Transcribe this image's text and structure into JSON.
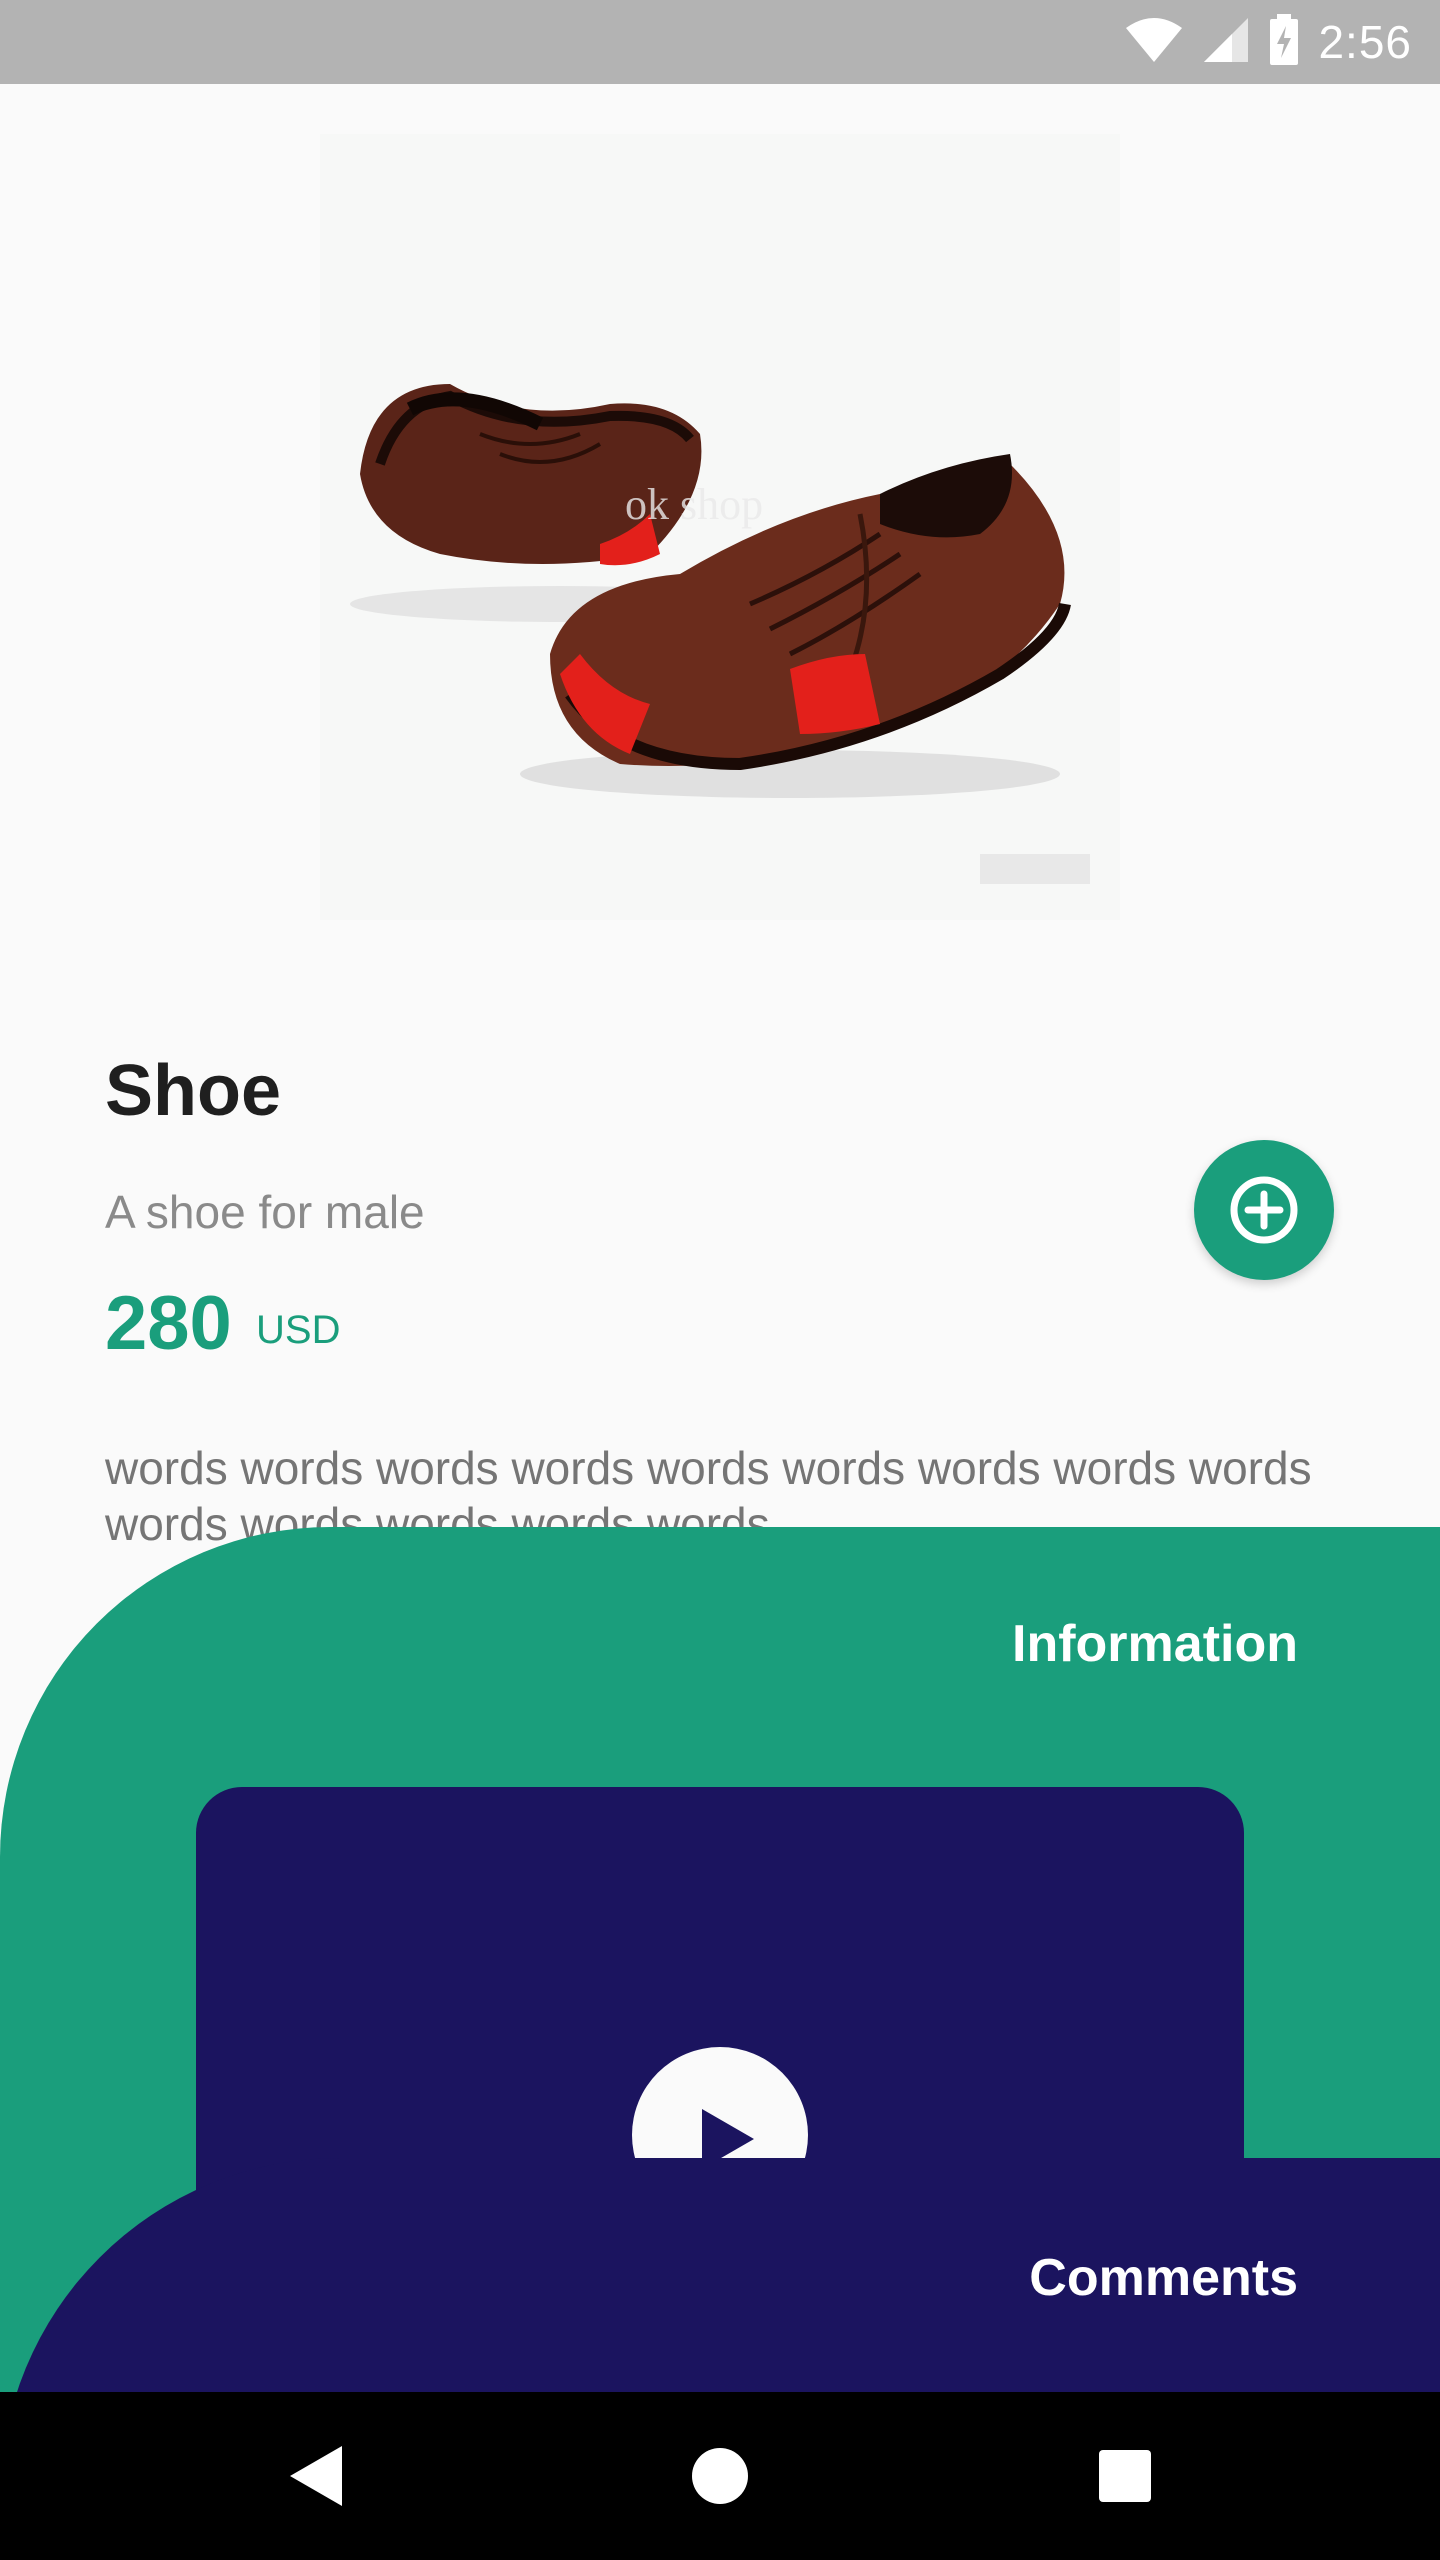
{
  "status_bar": {
    "time": "2:56",
    "icons": [
      "wifi-icon",
      "signal-icon",
      "battery-charging-icon"
    ]
  },
  "product": {
    "image_icon": "shoe-product-image",
    "image_watermark": "ok shop",
    "name": "Shoe",
    "subtitle": "A shoe for male",
    "price": "280",
    "currency": "USD",
    "description": "words words words words words words words words words words words words words words",
    "add_icon": "add-circle-icon"
  },
  "sheets": {
    "information": {
      "label": "Information"
    },
    "comments": {
      "label": "Comments"
    },
    "video": {
      "play_icon": "play-icon"
    }
  },
  "navigation": {
    "back_icon": "back-icon",
    "home_icon": "home-icon",
    "recents_icon": "recents-icon"
  },
  "colors": {
    "accent": "#1a9e7c",
    "navy": "#1b145f",
    "background": "#fafafa",
    "status_bar": "#b3b3b3"
  }
}
